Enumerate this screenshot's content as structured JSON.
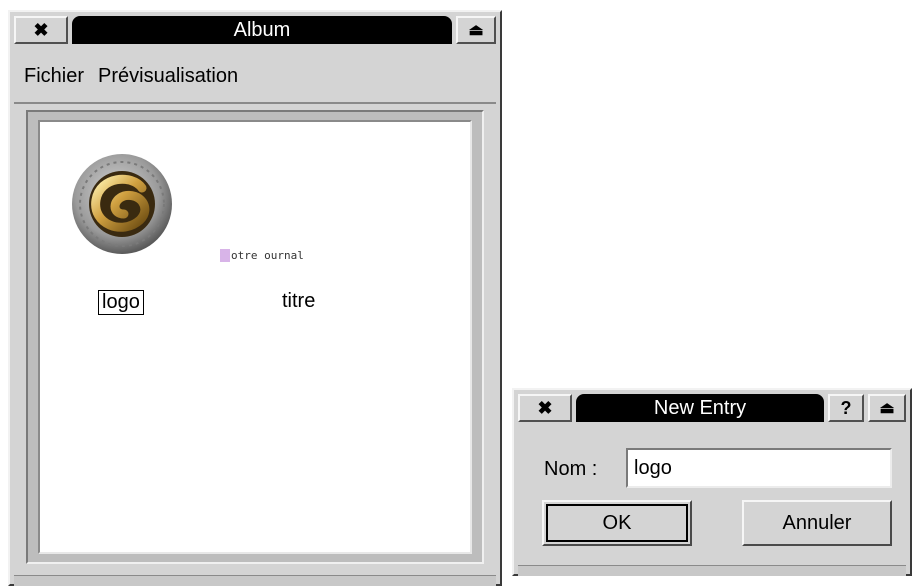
{
  "album_window": {
    "title": "Album",
    "close_icon": "✖",
    "collapse_icon": "⏏",
    "menu": [
      {
        "label": "Fichier"
      },
      {
        "label": "Prévisualisation"
      }
    ],
    "entries": [
      {
        "label": "logo",
        "selected": true,
        "icon": "gold-swirl-logo"
      },
      {
        "label": "titre",
        "selected": false,
        "image_text": "otre ournal"
      }
    ]
  },
  "dialog": {
    "title": "New Entry",
    "close_icon": "✖",
    "help_icon": "?",
    "collapse_icon": "⏏",
    "name_label": "Nom :",
    "name_value": "logo",
    "ok_label": "OK",
    "cancel_label": "Annuler"
  }
}
